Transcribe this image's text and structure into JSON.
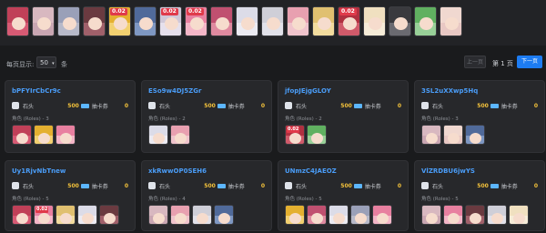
{
  "filter_bar": {
    "characters": [
      {
        "hair": "#c04058",
        "bg": "#d75a74",
        "cost": ""
      },
      {
        "hair": "#d8b8c0",
        "bg": "#c9a6b2",
        "cost": ""
      },
      {
        "hair": "#9aa0b8",
        "bg": "#b7b9c9",
        "cost": ""
      },
      {
        "hair": "#6a3a40",
        "bg": "#a0606a",
        "cost": ""
      },
      {
        "hair": "#e4b030",
        "bg": "#f2d070",
        "cost": "0.02"
      },
      {
        "hair": "#506a9a",
        "bg": "#7e97c2",
        "cost": ""
      },
      {
        "hair": "#d0c8d8",
        "bg": "#e6e0ec",
        "cost": "0.02"
      },
      {
        "hair": "#e880a0",
        "bg": "#f4b6c8",
        "cost": "0.02"
      },
      {
        "hair": "#c05070",
        "bg": "#e08aa0",
        "cost": ""
      },
      {
        "hair": "#dcdce8",
        "bg": "#ecebf2",
        "cost": ""
      },
      {
        "hair": "#cfcfd8",
        "bg": "#e2e2ea",
        "cost": ""
      },
      {
        "hair": "#e8a0b0",
        "bg": "#f0c4cc",
        "cost": ""
      },
      {
        "hair": "#e0c070",
        "bg": "#f2dc9e",
        "cost": ""
      },
      {
        "hair": "#b03040",
        "bg": "#d05a6a",
        "cost": "0.02"
      },
      {
        "hair": "#f0e0c0",
        "bg": "#f6ecd8",
        "cost": ""
      },
      {
        "hair": "#3a3a3e",
        "bg": "#6a6a70",
        "cost": ""
      },
      {
        "hair": "#60b060",
        "bg": "#98d098",
        "cost": ""
      },
      {
        "hair": "#f0d8d0",
        "bg": "#e8c8c4",
        "cost": ""
      }
    ]
  },
  "pager": {
    "per_page_label": "每页显示:",
    "per_page_value": "50",
    "per_page_unit": "条",
    "prev_label": "上一页",
    "page_indicator": "第 1 页",
    "next_label": "下一页"
  },
  "cards": [
    {
      "id": "bPFYIrCbCr9c",
      "stone_label": "石头",
      "stone_amount": "500",
      "ticket_label": "抽卡券",
      "ticket_amount": "0",
      "roles": "角色 (Roles) - 3",
      "chars": [
        {
          "hair": "#c04058",
          "bg": "#d75a74",
          "cost": ""
        },
        {
          "hair": "#e4b030",
          "bg": "#f2d070",
          "cost": ""
        },
        {
          "hair": "#e880a0",
          "bg": "#f4b6c8",
          "cost": ""
        }
      ]
    },
    {
      "id": "ESo9w4DJ5ZGr",
      "stone_label": "石头",
      "stone_amount": "500",
      "ticket_label": "抽卡券",
      "ticket_amount": "0",
      "roles": "角色 (Roles) - 2",
      "chars": [
        {
          "hair": "#dcdce8",
          "bg": "#ecebf2",
          "cost": ""
        },
        {
          "hair": "#e8a0b0",
          "bg": "#f0c4cc",
          "cost": ""
        }
      ]
    },
    {
      "id": "jfopJEjgGLOY",
      "stone_label": "石头",
      "stone_amount": "500",
      "ticket_label": "抽卡券",
      "ticket_amount": "0",
      "roles": "角色 (Roles) - 2",
      "chars": [
        {
          "hair": "#b03040",
          "bg": "#d05a6a",
          "cost": "0.02"
        },
        {
          "hair": "#60b060",
          "bg": "#98d098",
          "cost": ""
        }
      ]
    },
    {
      "id": "3SL2uXXwp5Hq",
      "stone_label": "石头",
      "stone_amount": "500",
      "ticket_label": "抽卡券",
      "ticket_amount": "0",
      "roles": "角色 (Roles) - 3",
      "chars": [
        {
          "hair": "#d8b8c0",
          "bg": "#c9a6b2",
          "cost": ""
        },
        {
          "hair": "#f0d8d0",
          "bg": "#e8c8c4",
          "cost": ""
        },
        {
          "hair": "#506a9a",
          "bg": "#7e97c2",
          "cost": ""
        }
      ]
    },
    {
      "id": "Uy1RjvNbTnew",
      "stone_label": "石头",
      "stone_amount": "500",
      "ticket_label": "抽卡券",
      "ticket_amount": "0",
      "roles": "角色 (Roles) - 5",
      "chars": [
        {
          "hair": "#c04058",
          "bg": "#d75a74",
          "cost": ""
        },
        {
          "hair": "#e880a0",
          "bg": "#f4b6c8",
          "cost": "0.02"
        },
        {
          "hair": "#e0c070",
          "bg": "#f2dc9e",
          "cost": ""
        },
        {
          "hair": "#dcdce8",
          "bg": "#ecebf2",
          "cost": ""
        },
        {
          "hair": "#6a3a40",
          "bg": "#a0606a",
          "cost": ""
        }
      ]
    },
    {
      "id": "xkRwwOP0SEH6",
      "stone_label": "石头",
      "stone_amount": "500",
      "ticket_label": "抽卡券",
      "ticket_amount": "0",
      "roles": "角色 (Roles) - 4",
      "chars": [
        {
          "hair": "#d8b8c0",
          "bg": "#c9a6b2",
          "cost": ""
        },
        {
          "hair": "#e8a0b0",
          "bg": "#f0c4cc",
          "cost": ""
        },
        {
          "hair": "#cfcfd8",
          "bg": "#e2e2ea",
          "cost": ""
        },
        {
          "hair": "#506a9a",
          "bg": "#7e97c2",
          "cost": ""
        }
      ]
    },
    {
      "id": "UNmzC4JAEOZ",
      "stone_label": "石头",
      "stone_amount": "500",
      "ticket_label": "抽卡券",
      "ticket_amount": "0",
      "roles": "角色 (Roles) - 5",
      "chars": [
        {
          "hair": "#e4b030",
          "bg": "#f2d070",
          "cost": ""
        },
        {
          "hair": "#c05070",
          "bg": "#e08aa0",
          "cost": ""
        },
        {
          "hair": "#dcdce8",
          "bg": "#ecebf2",
          "cost": ""
        },
        {
          "hair": "#9aa0b8",
          "bg": "#b7b9c9",
          "cost": ""
        },
        {
          "hair": "#e880a0",
          "bg": "#f4b6c8",
          "cost": ""
        }
      ]
    },
    {
      "id": "VlZRDBU6jwYS",
      "stone_label": "石头",
      "stone_amount": "500",
      "ticket_label": "抽卡券",
      "ticket_amount": "0",
      "roles": "角色 (Roles) - 5",
      "chars": [
        {
          "hair": "#d8b8c0",
          "bg": "#c9a6b2",
          "cost": ""
        },
        {
          "hair": "#e880a0",
          "bg": "#f4b6c8",
          "cost": ""
        },
        {
          "hair": "#6a3a40",
          "bg": "#a0606a",
          "cost": ""
        },
        {
          "hair": "#cfcfd8",
          "bg": "#e2e2ea",
          "cost": ""
        },
        {
          "hair": "#f0e0c0",
          "bg": "#f6ecd8",
          "cost": ""
        }
      ]
    }
  ]
}
